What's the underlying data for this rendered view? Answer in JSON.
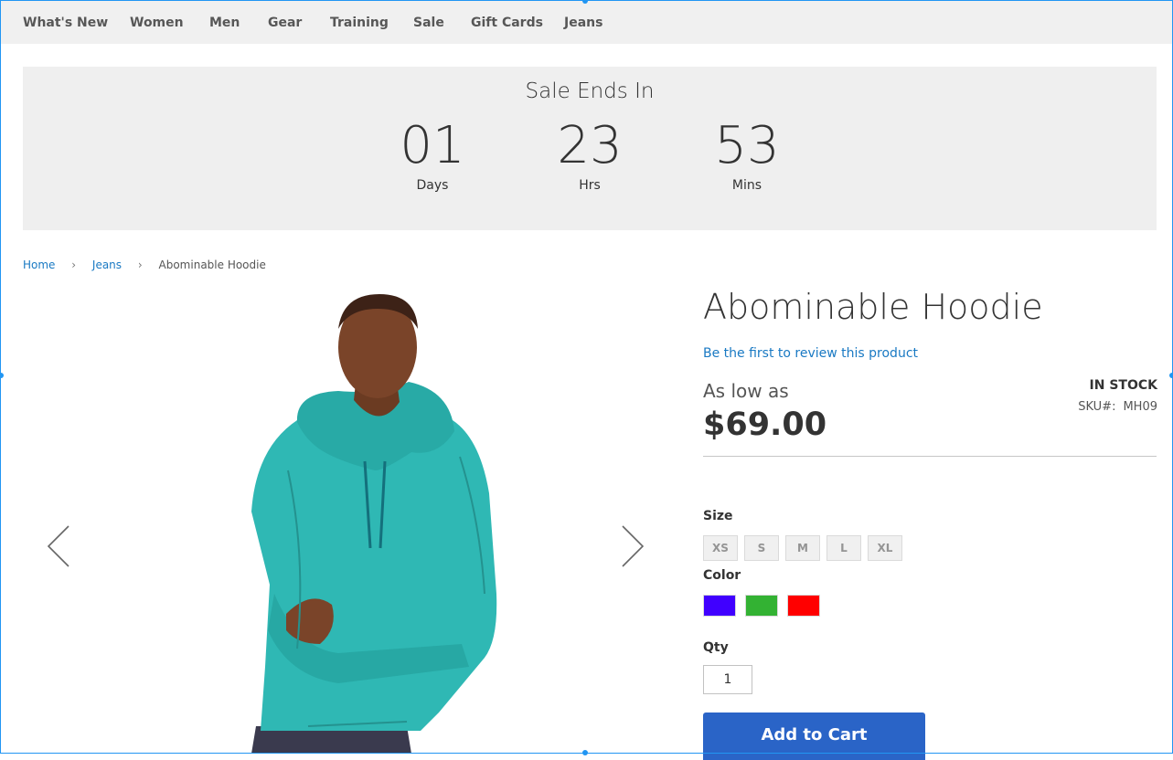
{
  "nav": {
    "items": [
      "What's New",
      "Women",
      "Men",
      "Gear",
      "Training",
      "Sale",
      "Gift Cards",
      "Jeans"
    ]
  },
  "countdown": {
    "title": "Sale Ends In",
    "days": {
      "value": "01",
      "label": "Days"
    },
    "hours": {
      "value": "23",
      "label": "Hrs"
    },
    "minutes": {
      "value": "53",
      "label": "Mins"
    }
  },
  "breadcrumb": {
    "home": "Home",
    "category": "Jeans",
    "current": "Abominable Hoodie",
    "separator": "›"
  },
  "product": {
    "name": "Abominable Hoodie",
    "review_link": "Be the first to review this product",
    "price_label": "As low as",
    "price": "$69.00",
    "stock": "IN STOCK",
    "sku_label": "SKU#:",
    "sku": "MH09",
    "image_color": "#2fb8b4"
  },
  "options": {
    "size_label": "Size",
    "sizes": [
      "XS",
      "S",
      "M",
      "L",
      "XL"
    ],
    "color_label": "Color",
    "colors": [
      "#4000ff",
      "#33b233",
      "#ff0000"
    ]
  },
  "cart": {
    "qty_label": "Qty",
    "qty_value": "1",
    "button_label": "Add to Cart"
  },
  "icons": {
    "prev": "chevron-left-icon",
    "next": "chevron-right-icon"
  }
}
